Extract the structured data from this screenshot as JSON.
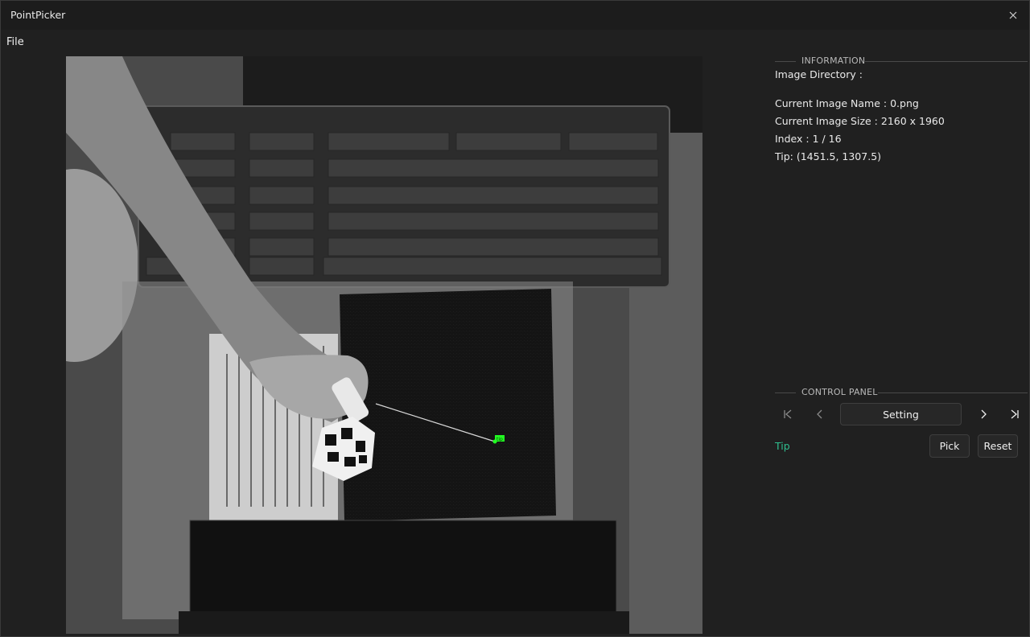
{
  "window": {
    "title": "PointPicker"
  },
  "menu": {
    "file": "File"
  },
  "info": {
    "group_title": "INFORMATION",
    "image_directory": "Image Directory :",
    "image_name": "Current Image Name : 0.png",
    "image_size": "Current Image Size : 2160 x 1960",
    "index": "Index : 1 / 16",
    "tip": "Tip: (1451.5, 1307.5)"
  },
  "control": {
    "group_title": "CONTROL PANEL",
    "setting_label": "Setting",
    "tip_label": "Tip",
    "pick_label": "Pick",
    "reset_label": "Reset"
  },
  "image": {
    "tip_marker_label": "tip"
  },
  "colors": {
    "accent_green": "#2fbf8f",
    "marker_green": "#22ff22",
    "background": "#202020"
  }
}
